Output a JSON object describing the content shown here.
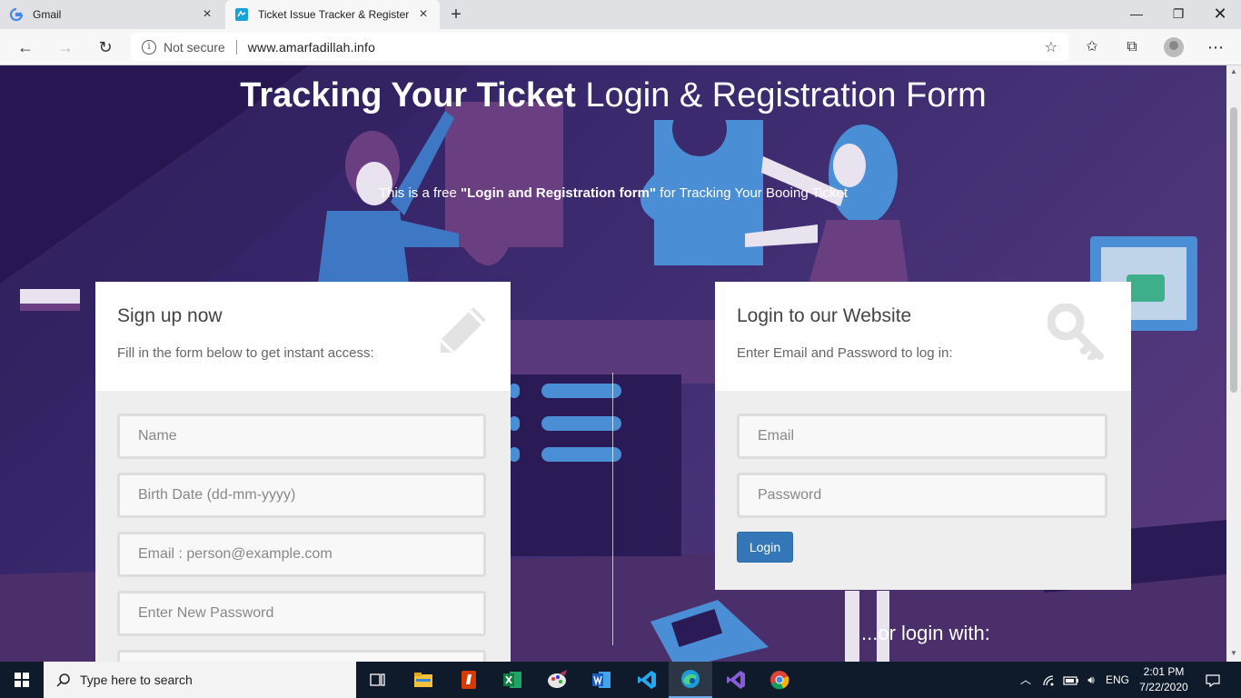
{
  "browser": {
    "tabs": [
      {
        "title": "Gmail",
        "favicon": "google-g-icon",
        "active": false
      },
      {
        "title": "Ticket Issue Tracker & Register",
        "favicon": "ticket-site-icon",
        "active": true
      }
    ],
    "security_label": "Not secure",
    "url": "www.amarfadillah.info"
  },
  "hero": {
    "title_bold": "Tracking Your Ticket",
    "title_rest": "Login & Registration Form",
    "subtitle_pre": "This is a free ",
    "subtitle_bold": "\"Login and Registration form\"",
    "subtitle_post": " for Tracking Your Booing Ticket"
  },
  "signup": {
    "title": "Sign up now",
    "description": "Fill in the form below to get instant access:",
    "icon": "pencil-icon",
    "fields": {
      "name": "Name",
      "birth_date": "Birth Date (dd-mm-yyyy)",
      "email": "Email : person@example.com",
      "password": "Enter New Password"
    }
  },
  "login": {
    "title": "Login to our Website",
    "description": "Enter Email and Password to log in:",
    "icon": "key-icon",
    "fields": {
      "email": "Email",
      "password": "Password"
    },
    "button": "Login"
  },
  "social": {
    "label": "...or login with:"
  },
  "taskbar": {
    "search_placeholder": "Type here to search",
    "language": "ENG",
    "time": "2:01 PM",
    "date": "7/22/2020"
  },
  "colors": {
    "accent_button": "#3377b8",
    "page_bg": "#2b1d5e",
    "taskbar_bg": "#0f1b2b"
  }
}
